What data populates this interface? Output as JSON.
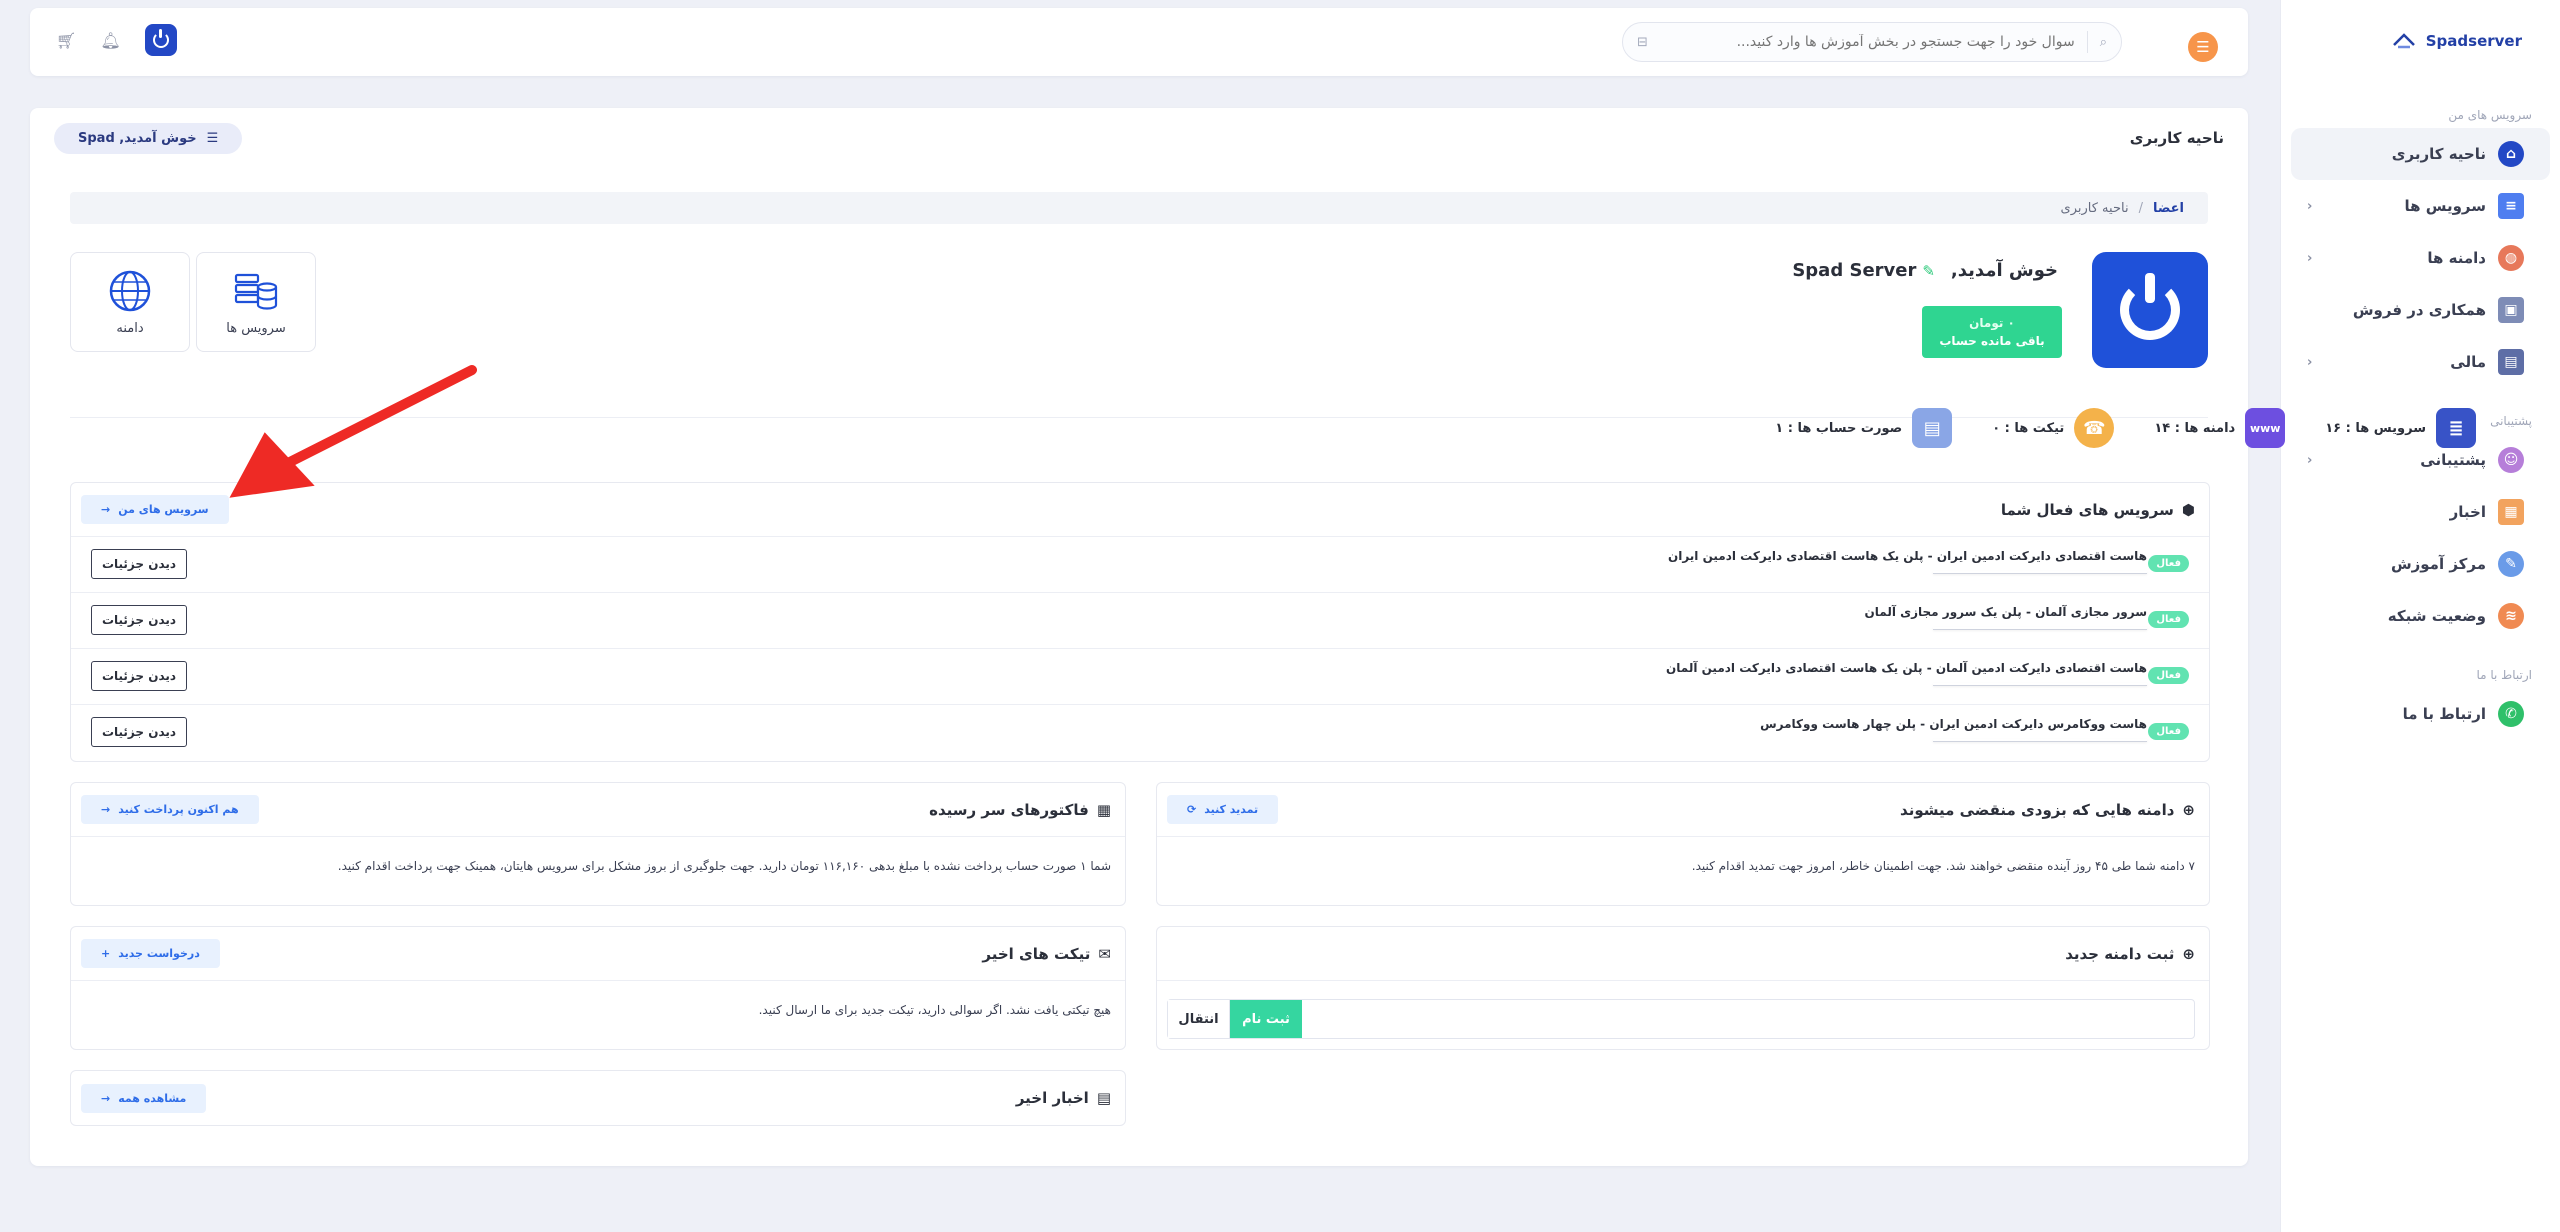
{
  "sidebar": {
    "brand": "Spadserver",
    "section_my_services": "سرویس های من",
    "section_support": "پشتیبانی",
    "section_contact": "ارتباط با ما",
    "items": [
      {
        "label": "ناحیه کاربری"
      },
      {
        "label": "سرویس ها"
      },
      {
        "label": "دامنه ها"
      },
      {
        "label": "همکاری در فروش"
      },
      {
        "label": "مالی"
      },
      {
        "label": "پشتیبانی"
      },
      {
        "label": "اخبار"
      },
      {
        "label": "مرکز آموزش"
      },
      {
        "label": "وضعیت شبکه"
      },
      {
        "label": "ارتباط با ما"
      }
    ]
  },
  "topbar": {
    "search_placeholder": "سوال خود را جهت جستجو در بخش آموزش ها وارد کنید..."
  },
  "panel": {
    "title": "ناحیه کاربری",
    "welcome": "خوش آمدید, Spad"
  },
  "breadcrumb": {
    "home": "اعضا",
    "separator": "/",
    "current": "ناحیه کاربری"
  },
  "profile": {
    "greeting": "خوش آمدید,",
    "name": "Spad Server",
    "balance_amount": "۰ تومان",
    "balance_label": "باقی مانده حساب"
  },
  "tiles": {
    "services": "سرویس ها",
    "domain": "دامنه"
  },
  "stats": {
    "services": "سرویس ها : ۱۶",
    "domains": "دامنه ها : ۱۴",
    "tickets": "تیکت ها : ۰",
    "invoices": "صورت حساب ها : ۱"
  },
  "active_services": {
    "title": "سرویس های فعال شما",
    "button": "سرویس های من",
    "rows": [
      {
        "badge": "فعال",
        "name": "هاست اقتصادی دایرکت ادمین ایران - پلن یک هاست اقتصادی دایرکت ادمین ایران",
        "action": "دیدن جزئیات"
      },
      {
        "badge": "فعال",
        "name": "سرور مجازی آلمان - پلن یک سرور مجازی آلمان",
        "action": "دیدن جزئیات"
      },
      {
        "badge": "فعال",
        "name": "هاست اقتصادی دایرکت ادمین آلمان - پلن یک هاست اقتصادی دایرکت ادمین آلمان",
        "action": "دیدن جزئیات"
      },
      {
        "badge": "فعال",
        "name": "هاست ووکامرس دایرکت ادمین ایران - پلن چهار هاست ووکامرس",
        "action": "دیدن جزئیات"
      }
    ]
  },
  "expiring_domains": {
    "title": "دامنه هایی که بزودی منقضی میشوند",
    "button": "تمدید کنید",
    "body": "۷ دامنه شما طی ۴۵ روز آینده منقضی خواهند شد. جهت اطمینان خاطر، امروز جهت تمدید اقدام کنید."
  },
  "due_invoices": {
    "title": "فاکتورهای سر رسیده",
    "button": "هم اکنون پرداخت کنید",
    "body": "شما ۱ صورت حساب پرداخت نشده با مبلغ بدهی ۱۱۶,۱۶۰ تومان دارید. جهت جلوگیری از بروز مشکل برای سرویس هایتان، همینک جهت پرداخت اقدام کنید."
  },
  "register_domain": {
    "title": "ثبت دامنه جدید",
    "register": "ثبت نام",
    "transfer": "انتقال"
  },
  "recent_tickets": {
    "title": "تیکت های اخیر",
    "button": "درخواست جدید",
    "body": "هیچ تیکتی یافت نشد. اگر سوالی دارید، تیکت جدید برای ما ارسال کنید."
  },
  "recent_news": {
    "title": "اخبار اخیر",
    "button": "مشاهده همه"
  },
  "colors": {
    "brand": "#2348c5",
    "success": "#2fd591",
    "accent": "#f7954a",
    "annotation_arrow": "#ee2a25"
  }
}
